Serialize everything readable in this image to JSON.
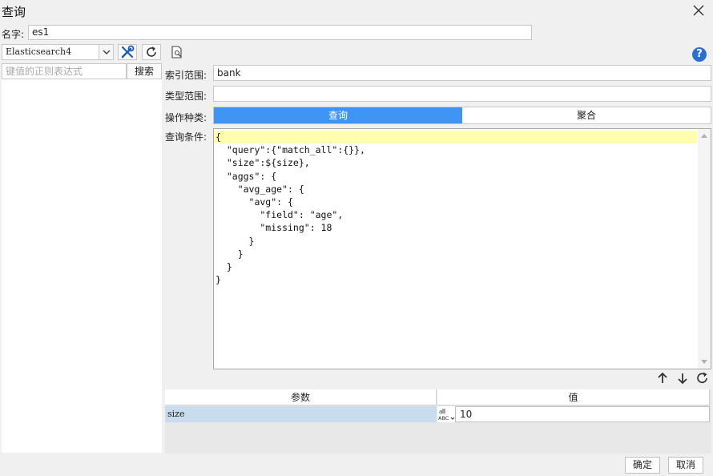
{
  "window": {
    "title": "查询"
  },
  "name": {
    "label": "名字:",
    "value": "es1"
  },
  "datasource": {
    "selected": "Elasticsearch4"
  },
  "search": {
    "placeholder": "键值的正则表达式",
    "button_label": "搜索"
  },
  "form": {
    "index_label": "索引范围:",
    "index_value": "bank",
    "type_label": "类型范围:",
    "type_value": "",
    "op_label": "操作种类:",
    "condition_label": "查询条件:"
  },
  "tabs": [
    {
      "label": "查询",
      "active": true
    },
    {
      "label": "聚合",
      "active": false
    }
  ],
  "editor": {
    "code": "{\n  \"query\":{\"match_all\":{}},\n  \"size\":${size},\n  \"aggs\": {\n    \"avg_age\": {\n      \"avg\": {\n        \"field\": \"age\",\n        \"missing\": 18\n      }\n    }\n  }\n}"
  },
  "params": {
    "header_name": "参数",
    "header_value": "值",
    "rows": [
      {
        "name": "size",
        "value": "10"
      }
    ]
  },
  "footer": {
    "ok_label": "确定",
    "cancel_label": "取消"
  },
  "icons": {
    "close": "close-icon",
    "settings": "tools-icon",
    "refresh": "refresh-icon",
    "preview": "preview-icon",
    "help": "help-icon",
    "up": "arrow-up-icon",
    "down": "arrow-down-icon",
    "reset": "refresh-icon",
    "type": "abc-type-icon"
  },
  "colors": {
    "accent": "#3f95f3",
    "highlight": "#ffffae",
    "help": "#2b6fd2",
    "selected_row": "#c8dced"
  }
}
